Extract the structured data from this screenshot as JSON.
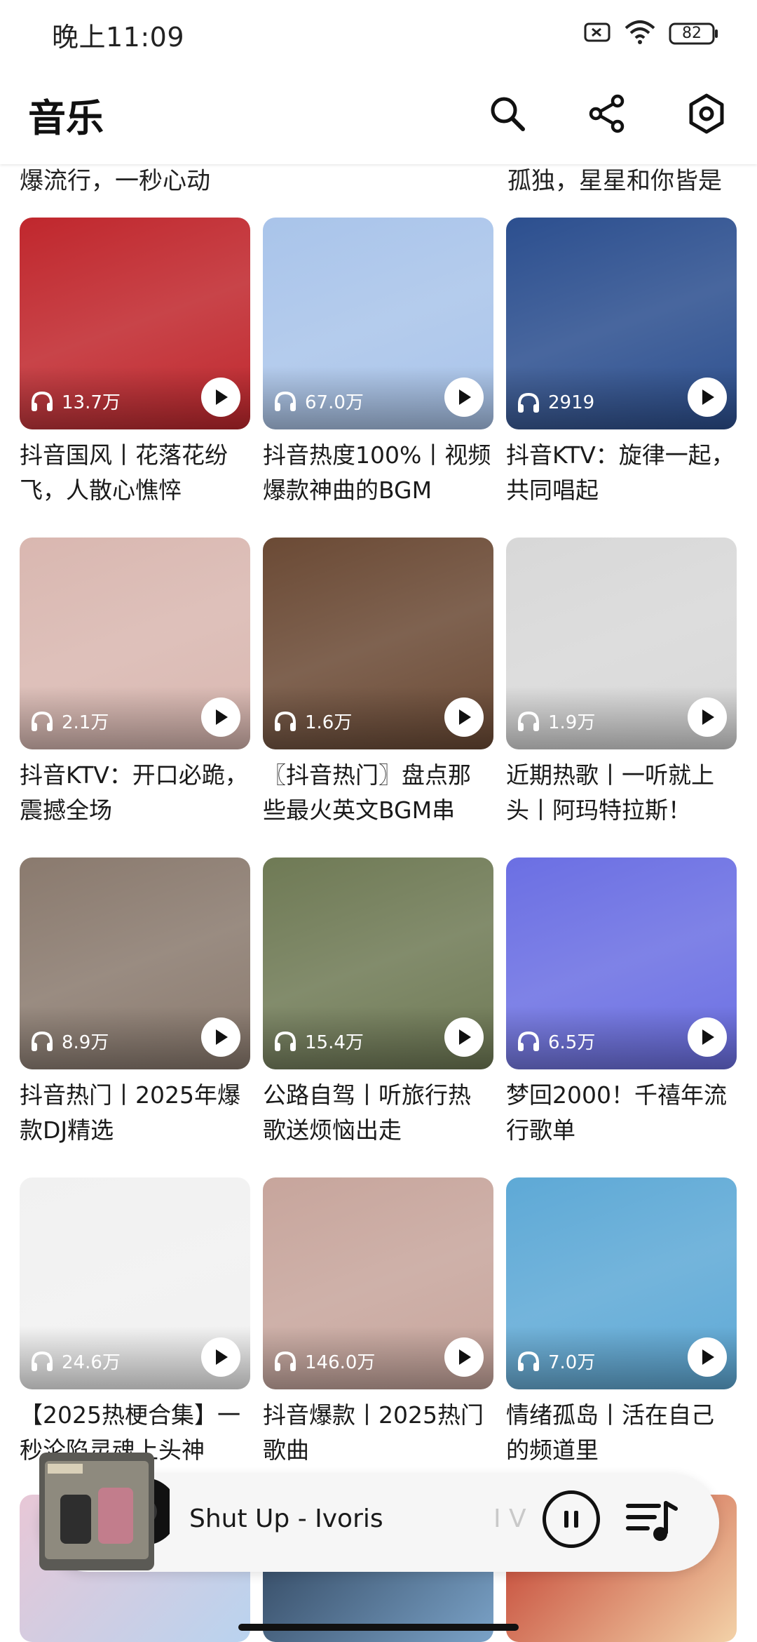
{
  "status_bar": {
    "time": "晚上11:09",
    "battery": "82"
  },
  "app_bar": {
    "title": "音乐",
    "icons": [
      "search-icon",
      "share-icon",
      "settings-icon"
    ]
  },
  "top_partial": {
    "left_caption": "爆流行，一秒心动",
    "right_caption": "孤独，星星和你皆是"
  },
  "playlists": [
    {
      "plays": "13.7万",
      "title": "抖音国风丨花落花纷飞，人散心憔悴",
      "bg": "#c0272d"
    },
    {
      "plays": "67.0万",
      "title": "抖音热度100%丨视频爆款神曲的BGM",
      "bg": "#a9c4ea"
    },
    {
      "plays": "2919",
      "title": "抖音KTV：旋律一起，共同唱起",
      "bg": "#2c4f8f"
    },
    {
      "plays": "2.1万",
      "title": "抖音KTV：开口必跪，震撼全场",
      "bg": "#d9b7b0"
    },
    {
      "plays": "1.6万",
      "title": "〖抖音热门〗盘点那些最火英文BGM串",
      "bg": "#6b4a35"
    },
    {
      "plays": "1.9万",
      "title": "近期热歌丨一听就上头丨阿玛特拉斯！",
      "bg": "#d8d8d8"
    },
    {
      "plays": "8.9万",
      "title": "抖音热门丨2025年爆款DJ精选",
      "bg": "#8a7a6e"
    },
    {
      "plays": "15.4万",
      "title": "公路自驾丨听旅行热歌送烦恼出走",
      "bg": "#6f7a55"
    },
    {
      "plays": "6.5万",
      "title": "梦回2000！千禧年流行歌单",
      "bg": "#6b6fe3"
    },
    {
      "plays": "24.6万",
      "title": "【2025热梗合集】一秒沦陷灵魂上头神",
      "bg": "#f1f1f1"
    },
    {
      "plays": "146.0万",
      "title": "抖音爆款丨2025热门歌曲",
      "bg": "#c7a59c"
    },
    {
      "plays": "7.0万",
      "title": "情绪孤岛丨活在自己的频道里",
      "bg": "#5ea9d6"
    }
  ],
  "mini_player": {
    "title": "Shut Up - Ivoris",
    "ghost_text": "I V"
  },
  "colors": {
    "accent_text": "#111111",
    "card_overlay": "#000000"
  }
}
